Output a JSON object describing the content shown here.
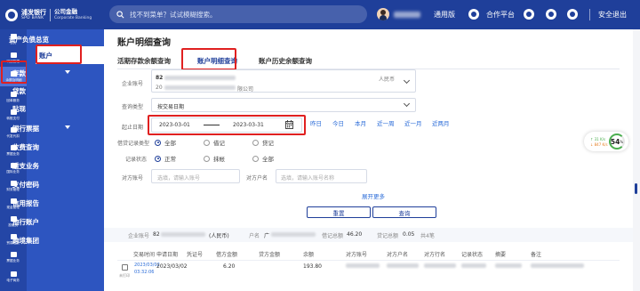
{
  "header": {
    "logo_cn": "浦发银行",
    "logo_en": "SPD BANK",
    "logo_sub": "公司金融",
    "logo_sub_en": "Corporate Banking",
    "search_placeholder": "找不到菜单？试试模糊搜索。",
    "tab_general": "通用版",
    "cooperation_platform": "合作平台",
    "logout": "安全退出"
  },
  "iconbar": [
    {
      "label": "首页"
    },
    {
      "label": "明细管理"
    },
    {
      "label": "余额及明细"
    },
    {
      "label": "回单服务"
    },
    {
      "label": "转账支付"
    },
    {
      "label": "代发代扣"
    },
    {
      "label": "票据业务"
    },
    {
      "label": "国际业务"
    },
    {
      "label": "财务管理"
    },
    {
      "label": "现金管理"
    },
    {
      "label": "投融资"
    },
    {
      "label": "贸易融资"
    },
    {
      "label": "票据业务"
    },
    {
      "label": "电子商务"
    }
  ],
  "menu": {
    "title": "资产负债总览",
    "items": [
      {
        "label": "账户",
        "selected": true
      },
      {
        "label": "存款",
        "caret": true
      },
      {
        "label": "贷款"
      },
      {
        "label": "贴现"
      },
      {
        "label": "银行票据",
        "caret": true
      },
      {
        "label": "收费查询"
      },
      {
        "label": "透支业务"
      },
      {
        "label": "支付密码"
      },
      {
        "label": "信用报告"
      },
      {
        "label": "他行账户"
      },
      {
        "label": "跨境集团"
      }
    ]
  },
  "page": {
    "title": "账户明细查询",
    "tabs": [
      "活期存款余额查询",
      "账户明细查询",
      "账户历史余额查询"
    ],
    "active_tab": 1
  },
  "form": {
    "account_label": "企业账号",
    "account_prefix": "82",
    "account_line2_prefix": "20",
    "account_line2_suffix": "限公司",
    "account_currency": "人民币",
    "query_type_label": "查询类型",
    "query_type_value": "按交易日期",
    "date_label": "起止日期",
    "date_start": "2023-03-01",
    "date_end": "2023-03-31",
    "quick_dates": [
      "昨日",
      "今日",
      "本月",
      "近一周",
      "近一月",
      "近两月"
    ],
    "debit_credit_label": "借贷记录类型",
    "debit_credit_options": [
      "全部",
      "借记",
      "贷记"
    ],
    "record_status_label": "记录状态",
    "record_status_options": [
      "正常",
      "抹帐",
      "全部"
    ],
    "counter_account_label": "对方账号",
    "counter_account_placeholder": "选填，请输入账号",
    "counter_name_label": "对方户名",
    "counter_name_placeholder": "选填，请输入账号名称",
    "expand_label": "展开更多",
    "reset_label": "重置",
    "query_label": "查询"
  },
  "summary": {
    "account_label": "企业账号",
    "account_value": "82",
    "currency": "(人民币)",
    "name_label": "户名",
    "name_value": "广",
    "debit_total_label": "借记总额",
    "debit_total_value": "46.20",
    "credit_total_label": "贷记总额",
    "credit_total_value": "0.05",
    "count_text": "共4笔"
  },
  "table": {
    "headers": [
      "交易时间",
      "申请日期",
      "凭证号",
      "借方金额",
      "贷方金额",
      "余额",
      "对方账号",
      "对方户名",
      "对方行名",
      "记录状态",
      "摘要",
      "备注"
    ],
    "rows": [
      {
        "time_date": "2023/03/02",
        "time_clock": "03:32:06",
        "apply_date": "2023/03/02",
        "debit": "6.20",
        "balance": "193.80",
        "marker": "未打印"
      }
    ]
  },
  "widget": {
    "percent": "54",
    "percent_sign": "%",
    "up": "↑ 31 K/s",
    "down": "↓ 847 K/s"
  }
}
